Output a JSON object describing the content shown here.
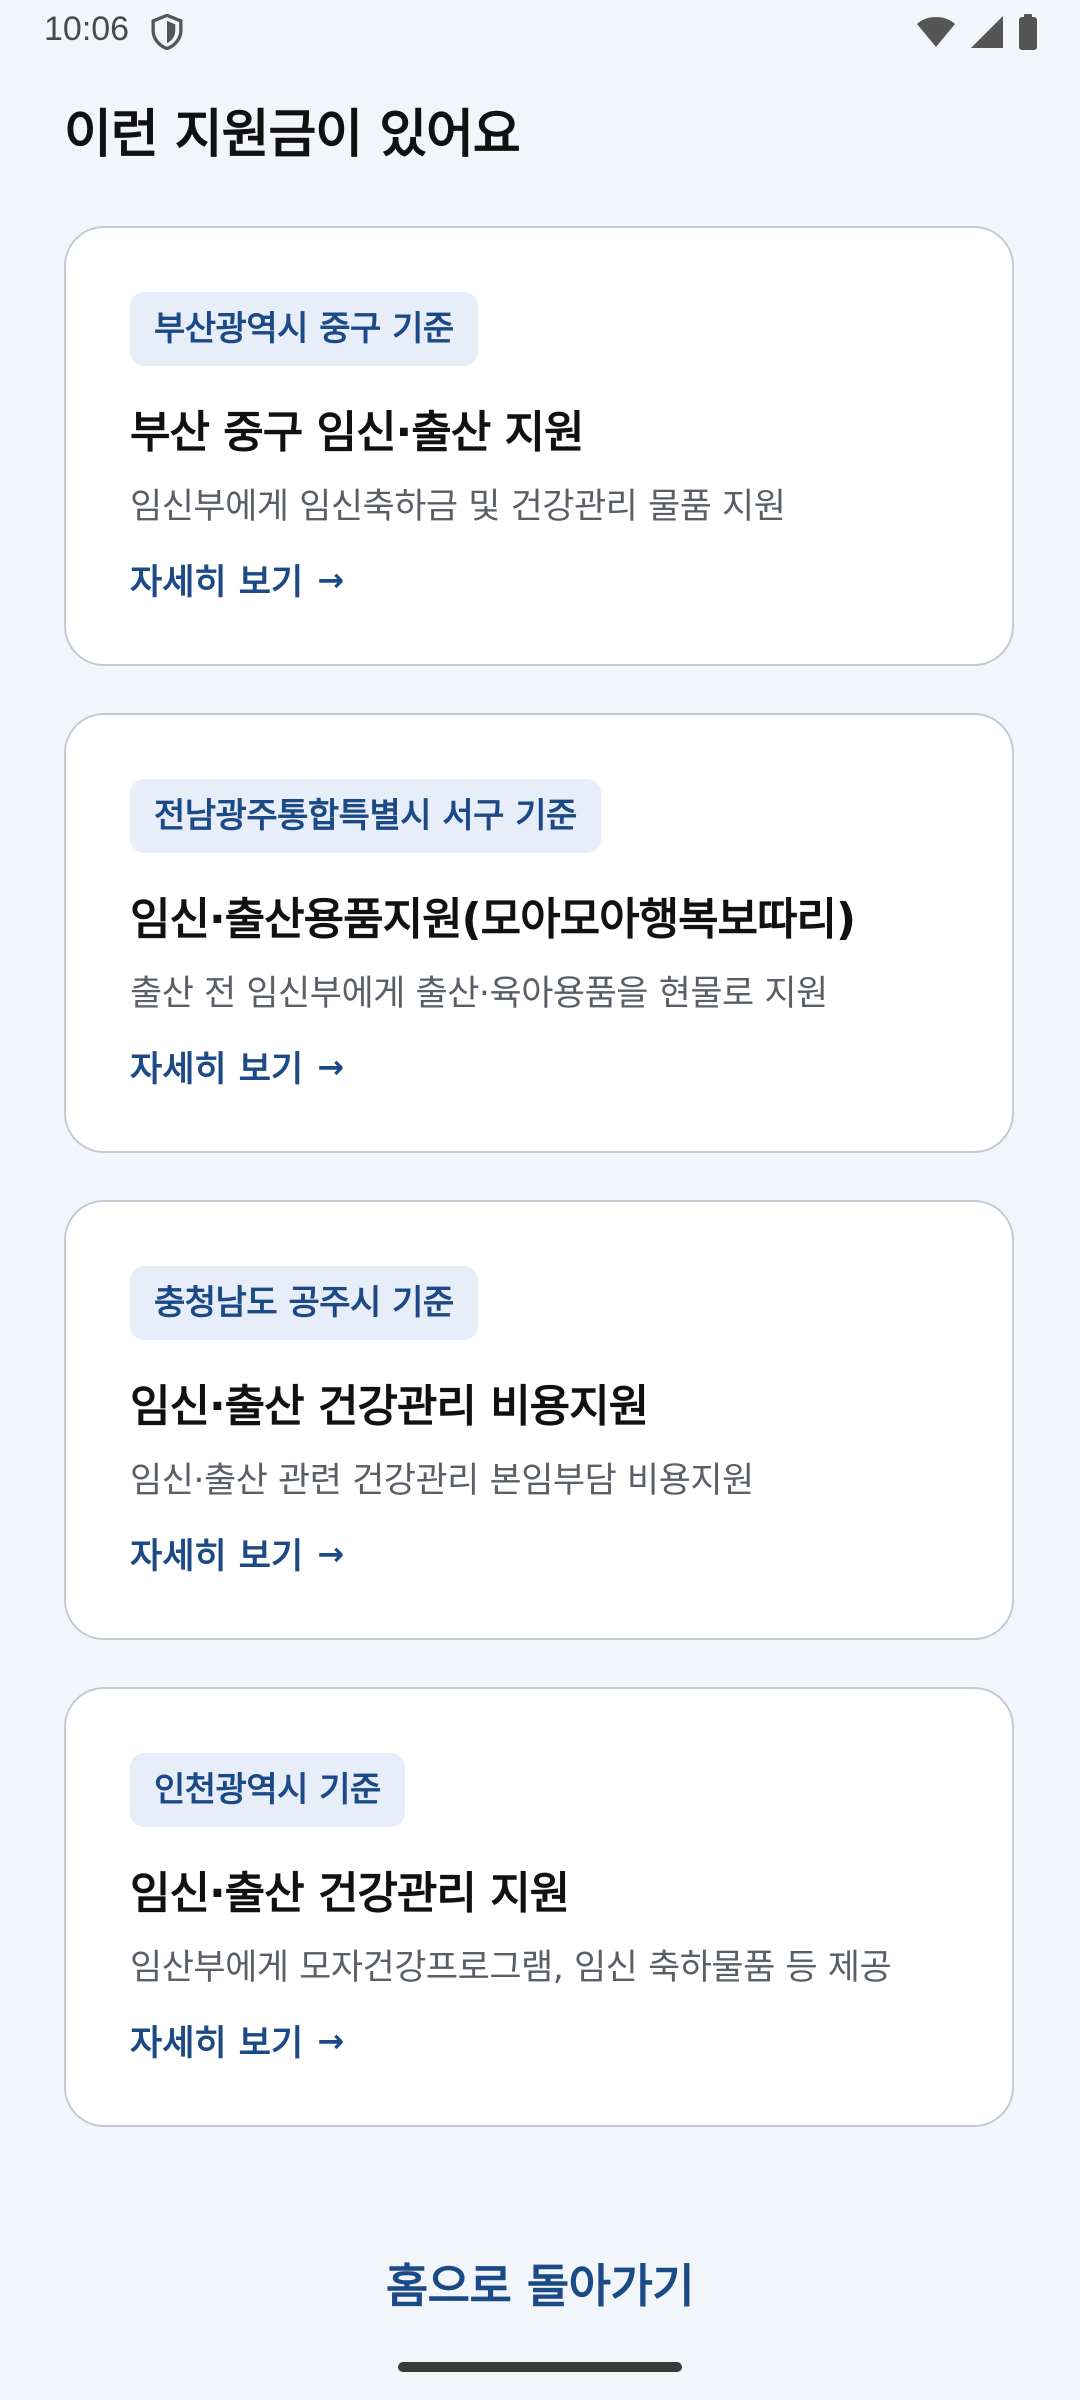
{
  "status_bar": {
    "time": "10:06",
    "icons": [
      "shield-icon",
      "wifi-icon",
      "cell-signal-icon",
      "battery-icon"
    ]
  },
  "page": {
    "title": "이런 지원금이 있어요"
  },
  "cards": [
    {
      "region": "부산광역시 중구 기준",
      "title": "부산 중구 임신·출산 지원",
      "description": "임신부에게 임신축하금 및 건강관리 물품 지원",
      "link_label": "자세히 보기",
      "link_arrow": "→"
    },
    {
      "region": "전남광주통합특별시 서구 기준",
      "title": "임신·출산용품지원(모아모아행복보따리)",
      "description": "출산 전 임신부에게 출산·육아용품을 현물로 지원",
      "link_label": "자세히 보기",
      "link_arrow": "→"
    },
    {
      "region": "충청남도 공주시 기준",
      "title": "임신·출산 건강관리 비용지원",
      "description": "임신·출산 관련 건강관리 본임부담 비용지원",
      "link_label": "자세히 보기",
      "link_arrow": "→"
    },
    {
      "region": "인천광역시 기준",
      "title": "임신·출산 건강관리 지원",
      "description": "임산부에게 모자건강프로그램, 임신 축하물품 등 제공",
      "link_label": "자세히 보기",
      "link_arrow": "→"
    }
  ],
  "footer": {
    "home_button_label": "홈으로 돌아가기"
  },
  "colors": {
    "background": "#f2f5fa",
    "accent": "#1c4a87",
    "badge_bg": "#e7eefa",
    "card_border": "#c3cad6"
  }
}
